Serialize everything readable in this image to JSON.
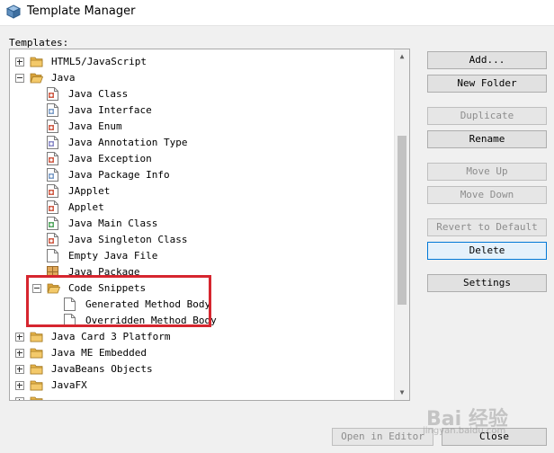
{
  "window": {
    "title": "Template Manager"
  },
  "tree": {
    "label": "Templates:",
    "rows": [
      {
        "label": "HTML5/JavaScript",
        "level": 0,
        "icon": "folder-icon",
        "expander": "plus"
      },
      {
        "label": "Java",
        "level": 0,
        "icon": "folder-open-icon",
        "expander": "minus"
      },
      {
        "label": "Java Class",
        "level": 1,
        "icon": "java-class-icon"
      },
      {
        "label": "Java Interface",
        "level": 1,
        "icon": "java-interface-icon"
      },
      {
        "label": "Java Enum",
        "level": 1,
        "icon": "java-enum-icon"
      },
      {
        "label": "Java Annotation Type",
        "level": 1,
        "icon": "java-annotation-icon"
      },
      {
        "label": "Java Exception",
        "level": 1,
        "icon": "java-exception-icon"
      },
      {
        "label": "Java Package Info",
        "level": 1,
        "icon": "java-package-info-icon"
      },
      {
        "label": "JApplet",
        "level": 1,
        "icon": "japplet-icon"
      },
      {
        "label": "Applet",
        "level": 1,
        "icon": "applet-icon"
      },
      {
        "label": "Java Main Class",
        "level": 1,
        "icon": "java-main-class-icon"
      },
      {
        "label": "Java Singleton Class",
        "level": 1,
        "icon": "java-singleton-icon"
      },
      {
        "label": "Empty Java File",
        "level": 1,
        "icon": "empty-file-icon"
      },
      {
        "label": "Java Package",
        "level": 1,
        "icon": "java-package-icon"
      },
      {
        "label": "Code Snippets",
        "level": 1,
        "icon": "folder-open-icon",
        "expander": "minus"
      },
      {
        "label": "Generated Method Body",
        "level": 2,
        "icon": "blank-file-icon"
      },
      {
        "label": "Overridden Method Body",
        "level": 2,
        "icon": "blank-file-icon"
      },
      {
        "label": "Java Card 3 Platform",
        "level": 0,
        "icon": "folder-icon",
        "expander": "plus"
      },
      {
        "label": "Java ME Embedded",
        "level": 0,
        "icon": "folder-icon",
        "expander": "plus"
      },
      {
        "label": "JavaBeans Objects",
        "level": 0,
        "icon": "folder-icon",
        "expander": "plus"
      },
      {
        "label": "JavaFX",
        "level": 0,
        "icon": "folder-icon",
        "expander": "plus"
      },
      {
        "label": "",
        "level": 0,
        "icon": "folder-icon",
        "expander": "plus"
      }
    ]
  },
  "buttons": {
    "add": "Add...",
    "new_folder": "New Folder",
    "duplicate": "Duplicate",
    "rename": "Rename",
    "move_up": "Move Up",
    "move_down": "Move Down",
    "revert": "Revert to Default",
    "delete": "Delete",
    "settings": "Settings",
    "open_in_editor": "Open in Editor",
    "close": "Close"
  },
  "watermark": {
    "text": "Bai 经验",
    "sub": "jingyan.baidu.com"
  },
  "colors": {
    "highlight": "#d6262f",
    "focus": "#0078d7",
    "folder": "#e8b54a"
  }
}
